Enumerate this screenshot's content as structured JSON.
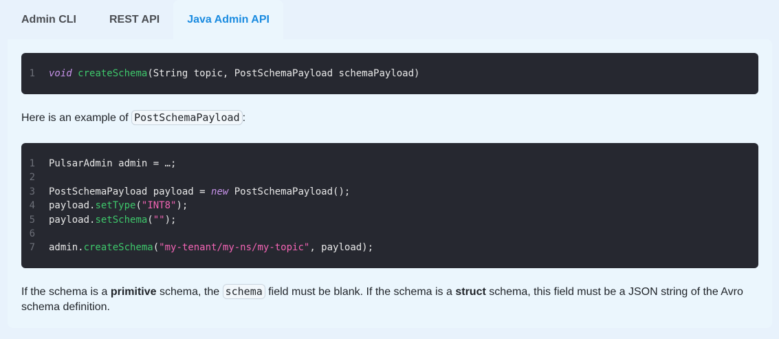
{
  "tabs": [
    {
      "label": "Admin CLI"
    },
    {
      "label": "REST API"
    },
    {
      "label": "Java Admin API"
    }
  ],
  "signature": {
    "ln": "1",
    "kw": "void",
    "fn": "createSchema",
    "rest": "(String topic, PostSchemaPayload schemaPayload)"
  },
  "intro": {
    "before": "Here is an example of ",
    "code": "PostSchemaPayload",
    "after": ":"
  },
  "example": {
    "line1": "PulsarAdmin admin = …;",
    "line3_a": "PostSchemaPayload payload = ",
    "line3_kw": "new",
    "line3_b": " PostSchemaPayload();",
    "line4_obj": "payload.",
    "line4_fn": "setType",
    "line4_open": "(",
    "line4_str": "\"INT8\"",
    "line4_close": ");",
    "line5_obj": "payload.",
    "line5_fn": "setSchema",
    "line5_open": "(",
    "line5_str": "\"\"",
    "line5_close": ");",
    "line7_obj": "admin.",
    "line7_fn": "createSchema",
    "line7_open": "(",
    "line7_str": "\"my-tenant/my-ns/my-topic\"",
    "line7_close": ", payload);"
  },
  "line_numbers": [
    "1",
    "2",
    "3",
    "4",
    "5",
    "6",
    "7"
  ],
  "note": {
    "t1": "If the schema is a ",
    "b1": "primitive",
    "t2": " schema, the ",
    "code": "schema",
    "t3": " field must be blank. If the schema is a ",
    "b2": "struct",
    "t4": " schema, this field must be a JSON string of the Avro schema definition."
  }
}
